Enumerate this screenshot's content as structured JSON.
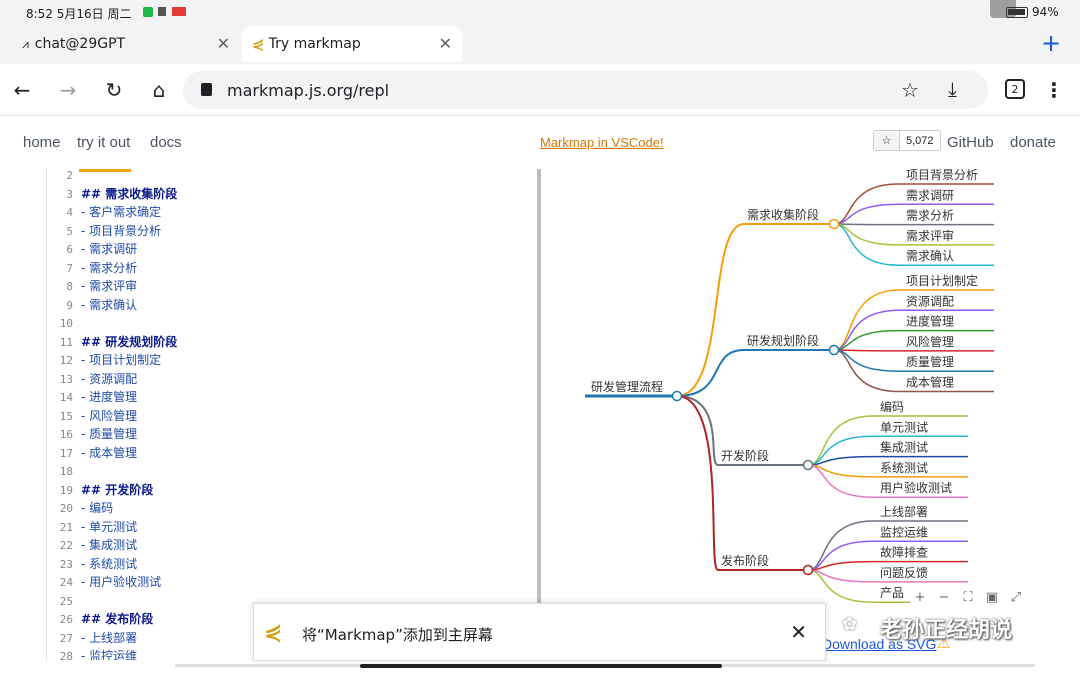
{
  "status": {
    "time": "8:52 5月16日 周二",
    "battery": "94%"
  },
  "tabs": [
    {
      "label": "chat@29GPT"
    },
    {
      "label": "Try markmap"
    }
  ],
  "omnibox": {
    "url": "markmap.js.org/repl",
    "tab_count": "2"
  },
  "nav": {
    "home": "home",
    "try": "try it out",
    "docs": "docs",
    "vscode": "Markmap in VSCode!",
    "stars": "5,072",
    "github": "GitHub",
    "donate": "donate"
  },
  "editor_lines": [
    {
      "n": "2",
      "t": "",
      "h": false
    },
    {
      "n": "3",
      "t": "##  需求收集阶段",
      "h": true
    },
    {
      "n": "4",
      "t": "-  客户需求确定",
      "h": false
    },
    {
      "n": "5",
      "t": "-  项目背景分析",
      "h": false
    },
    {
      "n": "6",
      "t": "-  需求调研",
      "h": false
    },
    {
      "n": "7",
      "t": "-  需求分析",
      "h": false
    },
    {
      "n": "8",
      "t": "-  需求评审",
      "h": false
    },
    {
      "n": "9",
      "t": "-  需求确认",
      "h": false
    },
    {
      "n": "10",
      "t": "",
      "h": false
    },
    {
      "n": "11",
      "t": "##  研发规划阶段",
      "h": true
    },
    {
      "n": "12",
      "t": "-  项目计划制定",
      "h": false
    },
    {
      "n": "13",
      "t": "-  资源调配",
      "h": false
    },
    {
      "n": "14",
      "t": "-  进度管理",
      "h": false
    },
    {
      "n": "15",
      "t": "-  风险管理",
      "h": false
    },
    {
      "n": "16",
      "t": "-  质量管理",
      "h": false
    },
    {
      "n": "17",
      "t": "-  成本管理",
      "h": false
    },
    {
      "n": "18",
      "t": "",
      "h": false
    },
    {
      "n": "19",
      "t": "##  开发阶段",
      "h": true
    },
    {
      "n": "20",
      "t": "-  编码",
      "h": false
    },
    {
      "n": "21",
      "t": "-  单元测试",
      "h": false
    },
    {
      "n": "22",
      "t": "-  集成测试",
      "h": false
    },
    {
      "n": "23",
      "t": "-  系统测试",
      "h": false
    },
    {
      "n": "24",
      "t": "-  用户验收测试",
      "h": false
    },
    {
      "n": "25",
      "t": "",
      "h": false
    },
    {
      "n": "26",
      "t": "##  发布阶段",
      "h": true
    },
    {
      "n": "27",
      "t": "-  上线部署",
      "h": false
    },
    {
      "n": "28",
      "t": "-  监控运维",
      "h": false
    }
  ],
  "mindmap": {
    "root": "研发管理流程",
    "branches": [
      {
        "label": "需求收集阶段",
        "color": "#f59e0b",
        "leaves": [
          "项目背景分析",
          "需求调研",
          "需求分析",
          "需求评审",
          "需求确认"
        ],
        "leaf_colors": [
          "#a0522d",
          "#8b5cf6",
          "#6b7280",
          "#a3c43a",
          "#22b8cf"
        ]
      },
      {
        "label": "研发规划阶段",
        "color": "#1f77b4",
        "leaves": [
          "项目计划制定",
          "资源调配",
          "进度管理",
          "风险管理",
          "质量管理",
          "成本管理"
        ],
        "leaf_colors": [
          "#f59e0b",
          "#8b5cf6",
          "#2ca02c",
          "#d62728",
          "#1f77b4",
          "#8c564b"
        ]
      },
      {
        "label": "开发阶段",
        "color": "#6b7280",
        "leaves": [
          "编码",
          "单元测试",
          "集成测试",
          "系统测试",
          "用户验收测试"
        ],
        "leaf_colors": [
          "#a3c43a",
          "#22b8cf",
          "#1f4aa8",
          "#f59e0b",
          "#e377c2"
        ]
      },
      {
        "label": "发布阶段",
        "color": "#b22222",
        "leaves": [
          "上线部署",
          "监控运维",
          "故障排查",
          "问题反馈",
          "产品"
        ],
        "leaf_colors": [
          "#6b7280",
          "#8b5cf6",
          "#d62728",
          "#e377c2",
          "#a3c43a"
        ]
      }
    ]
  },
  "banner": {
    "text": "将“Markmap”添加到主屏幕"
  },
  "download": "Download as SVG",
  "watermark": "老孙正经胡说"
}
